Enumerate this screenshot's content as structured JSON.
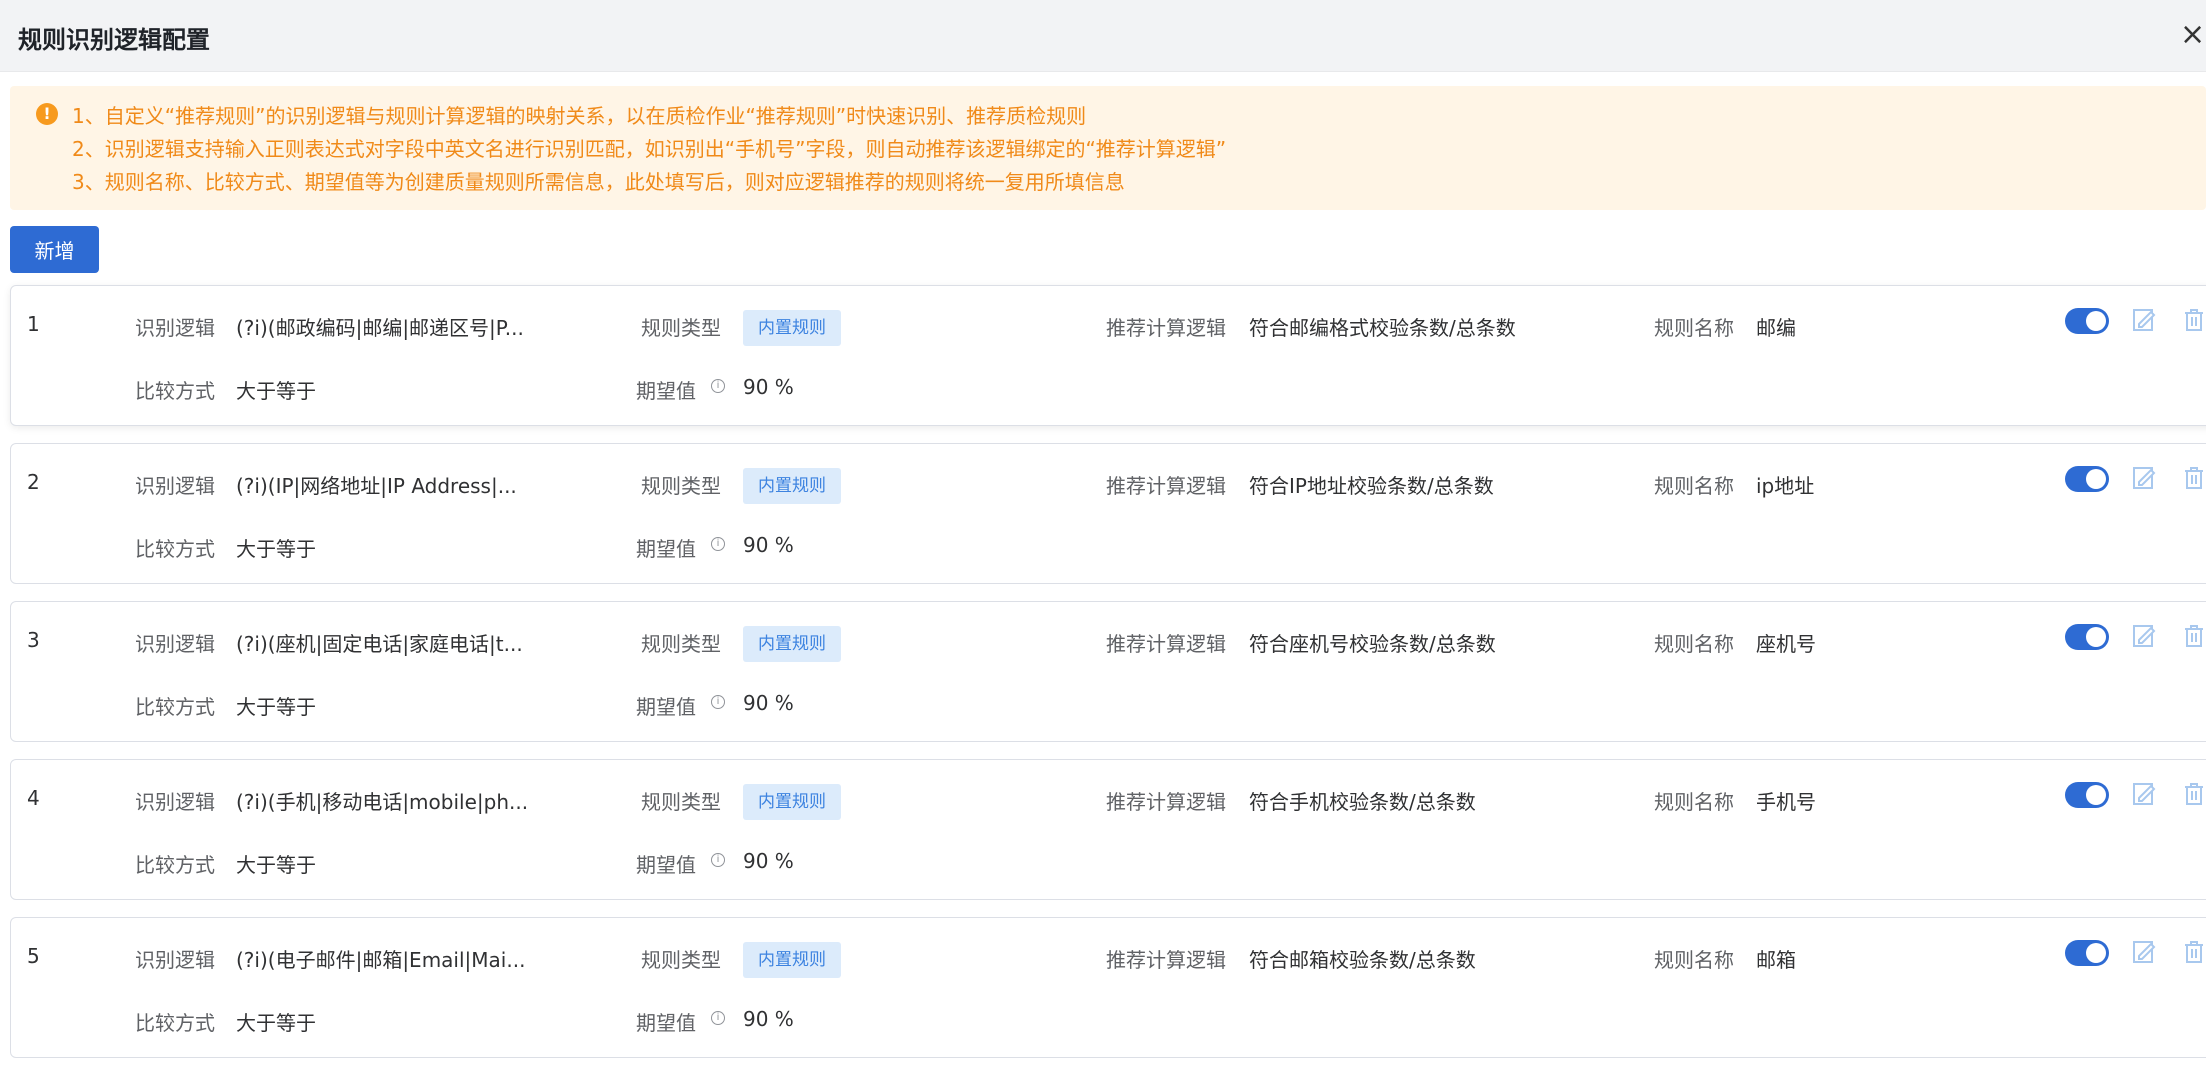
{
  "dialog": {
    "title": "规则识别逻辑配置",
    "close_symbol": "×"
  },
  "notice": {
    "icon": "!",
    "lines": [
      "1、自定义“推荐规则”的识别逻辑与规则计算逻辑的映射关系，以在质检作业“推荐规则”时快速识别、推荐质检规则",
      "2、识别逻辑支持输入正则表达式对字段中英文名进行识别匹配，如识别出“手机号”字段，则自动推荐该逻辑绑定的“推荐计算逻辑”",
      "3、规则名称、比较方式、期望值等为创建质量规则所需信息，此处填写后，则对应逻辑推荐的规则将统一复用所填信息"
    ]
  },
  "toolbar": {
    "add_label": "新增"
  },
  "labels": {
    "logic": "识别逻辑",
    "rule_type": "规则类型",
    "calc": "推荐计算逻辑",
    "rule_name": "规则名称",
    "compare": "比较方式",
    "expect": "期望值"
  },
  "rules": [
    {
      "index": "1",
      "logic": "(?i)(邮政编码|邮编|邮递区号|P...",
      "rule_type": "内置规则",
      "calc": "符合邮编格式校验条数/总条数",
      "rule_name": "邮编",
      "compare": "大于等于",
      "expect": "90 %",
      "enabled": true
    },
    {
      "index": "2",
      "logic": "(?i)(IP|网络地址|IP Address|...",
      "rule_type": "内置规则",
      "calc": "符合IP地址校验条数/总条数",
      "rule_name": "ip地址",
      "compare": "大于等于",
      "expect": "90 %",
      "enabled": true
    },
    {
      "index": "3",
      "logic": "(?i)(座机|固定电话|家庭电话|t...",
      "rule_type": "内置规则",
      "calc": "符合座机号校验条数/总条数",
      "rule_name": "座机号",
      "compare": "大于等于",
      "expect": "90 %",
      "enabled": true
    },
    {
      "index": "4",
      "logic": "(?i)(手机|移动电话|mobile|ph...",
      "rule_type": "内置规则",
      "calc": "符合手机校验条数/总条数",
      "rule_name": "手机号",
      "compare": "大于等于",
      "expect": "90 %",
      "enabled": true
    },
    {
      "index": "5",
      "logic": "(?i)(电子邮件|邮箱|Email|Mai...",
      "rule_type": "内置规则",
      "calc": "符合邮箱校验条数/总条数",
      "rule_name": "邮箱",
      "compare": "大于等于",
      "expect": "90 %",
      "enabled": true
    }
  ],
  "icons": {
    "info": "info-circle-icon",
    "edit": "edit-icon",
    "delete": "trash-icon",
    "toggle": "switch-on"
  },
  "colors": {
    "primary": "#2e6bd3",
    "notice_bg": "#fff5e6",
    "notice_text": "#f08a19",
    "tag_bg": "#dcebfb",
    "tag_text": "#3d83e0",
    "action_icon": "#a8c8ee"
  }
}
